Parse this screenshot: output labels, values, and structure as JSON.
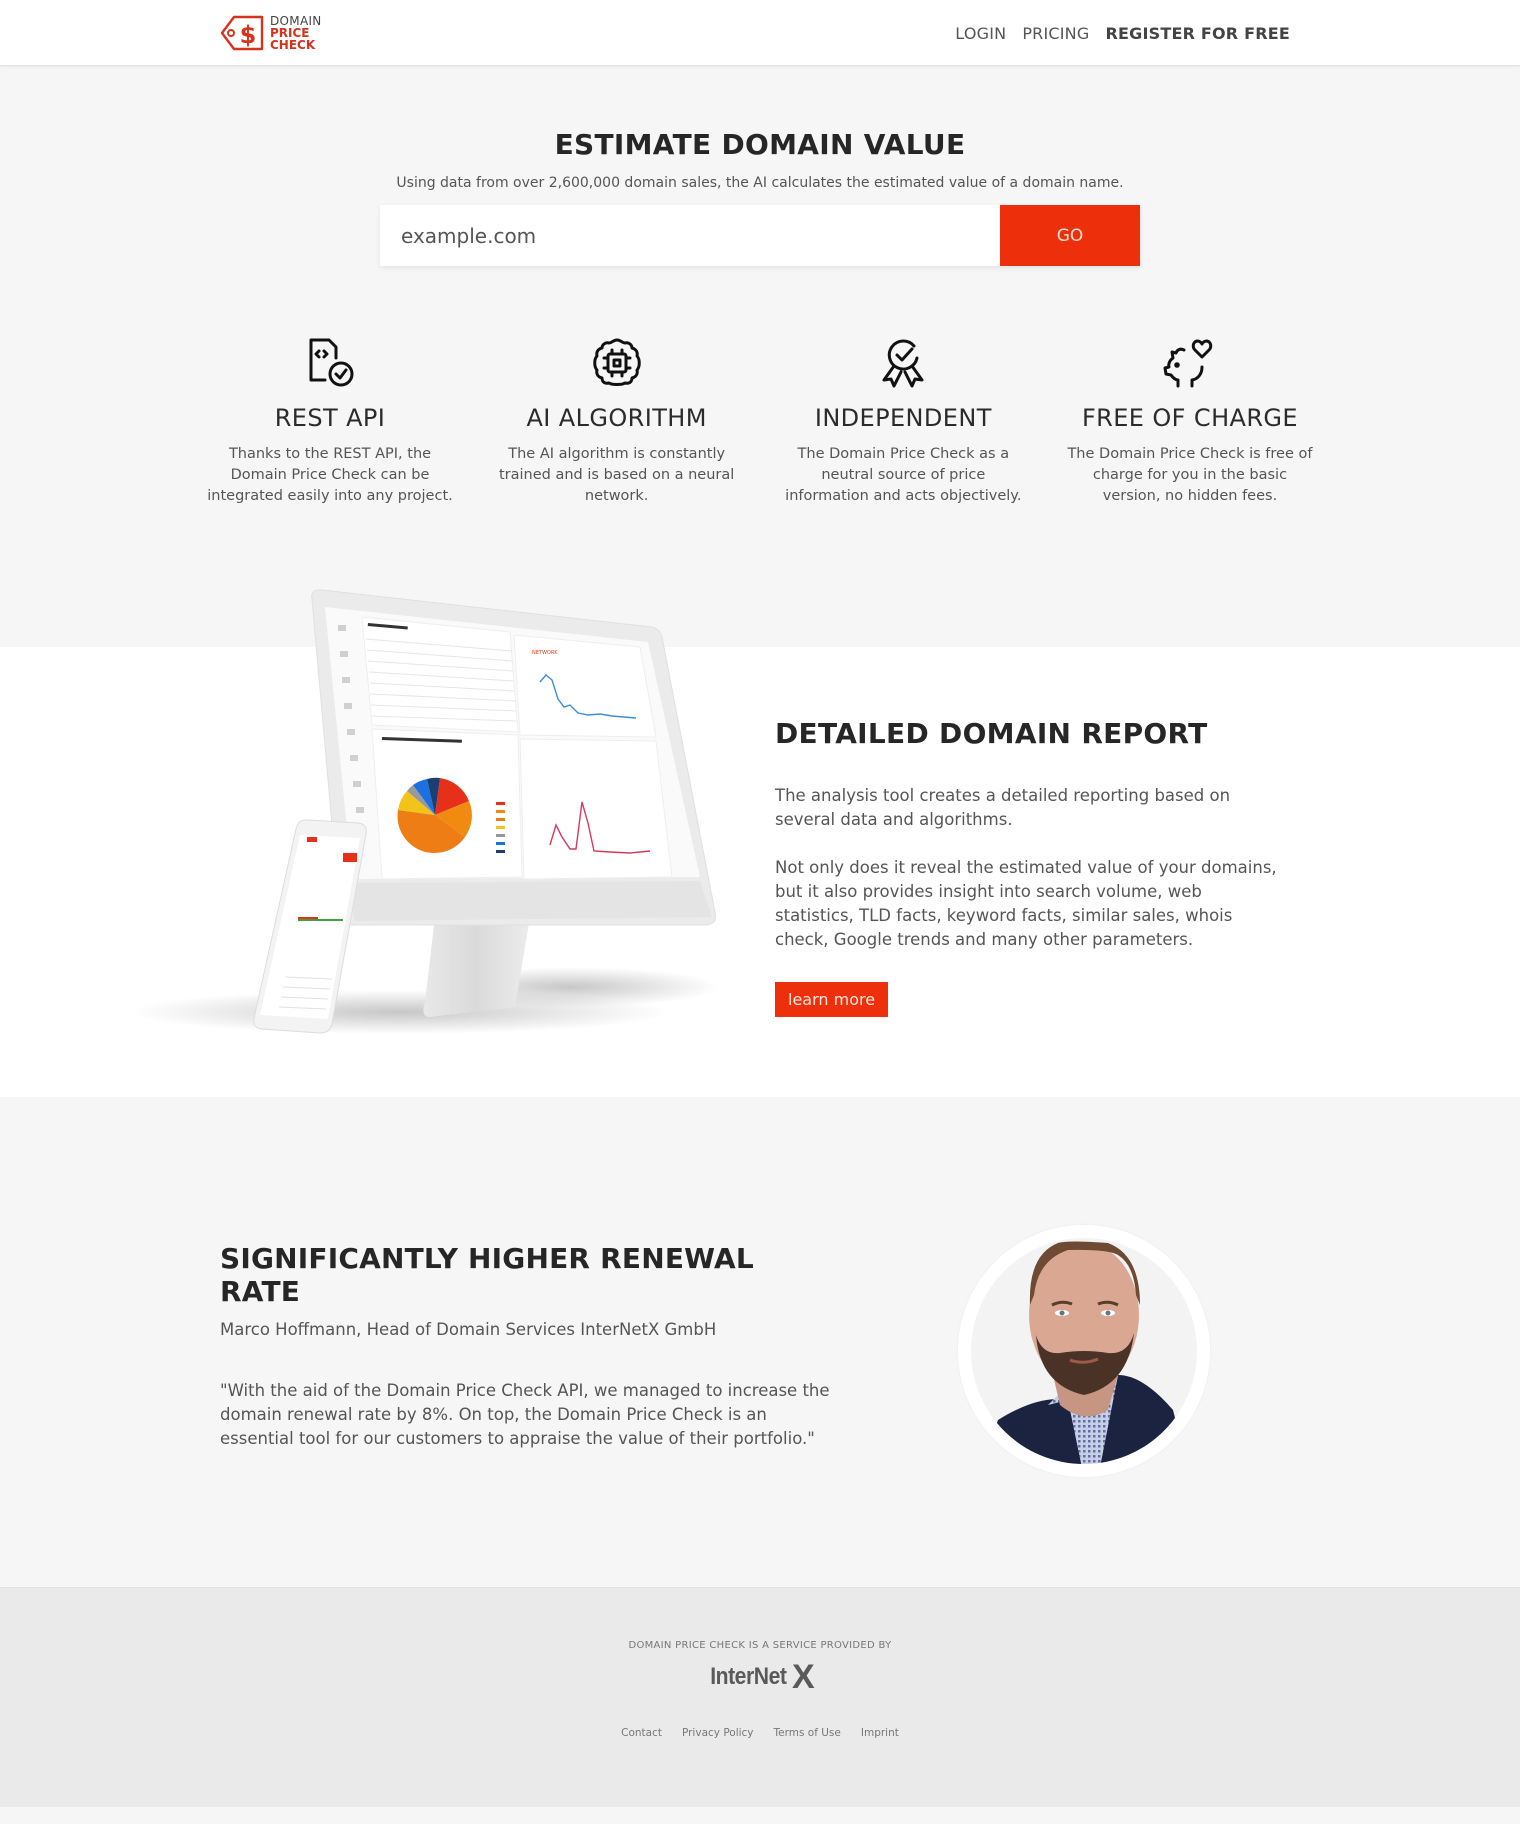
{
  "header": {
    "logo": {
      "line1": "DOMAIN",
      "line2": "PRICE",
      "line3": "CHECK",
      "icon": "price-tag-dollar-icon"
    },
    "nav": [
      {
        "label": "LOGIN"
      },
      {
        "label": "PRICING"
      },
      {
        "label": "REGISTER FOR FREE"
      }
    ]
  },
  "hero": {
    "title": "ESTIMATE DOMAIN VALUE",
    "subtitle": "Using data from over 2,600,000 domain sales, the AI calculates the estimated value of a domain name.",
    "search_placeholder": "example.com",
    "go_label": "GO"
  },
  "features": [
    {
      "icon": "file-code-check-icon",
      "title": "REST API",
      "text": "Thanks to the REST API, the Domain Price Check can be integrated easily into any project."
    },
    {
      "icon": "ai-chip-icon",
      "title": "AI ALGORITHM",
      "text": "The AI algorithm is constantly trained and is based on a neural network."
    },
    {
      "icon": "award-badge-check-icon",
      "title": "INDEPENDENT",
      "text": "The Domain Price Check as a neutral source of price information and acts objectively."
    },
    {
      "icon": "piggy-bank-heart-icon",
      "title": "FREE OF CHARGE",
      "text": "The Domain Price Check is free of charge for you in the basic version, no hidden fees."
    }
  ],
  "report": {
    "title": "DETAILED DOMAIN REPORT",
    "paragraph1": "The analysis tool creates a detailed reporting based on several data and algorithms.",
    "paragraph2": "Not only does it reveal the estimated value of your domains, but it also provides insight into search volume, web statistics, TLD facts, keyword facts, similar sales, whois check, Google trends and many other parameters.",
    "button_label": "learn more"
  },
  "testimonial": {
    "title": "SIGNIFICANTLY HIGHER RENEWAL RATE",
    "author": "Marco Hoffmann, Head of Domain Services InterNetX GmbH",
    "quote": "\"With the aid of the Domain Price Check API, we managed to increase the domain renewal rate by 8%. On top, the Domain Price Check is an essential tool for our customers to appraise the value of their portfolio.\""
  },
  "footer": {
    "provided_by": "DOMAIN PRICE CHECK IS A SERVICE PROVIDED BY",
    "brand": "InterNet",
    "brand_x": "X",
    "links": [
      {
        "label": "Contact"
      },
      {
        "label": "Privacy Policy"
      },
      {
        "label": "Terms of Use"
      },
      {
        "label": "Imprint"
      }
    ]
  },
  "colors": {
    "accent": "#ed2f0b",
    "logo_red": "#d6321c",
    "heading": "#262626",
    "body_text": "#555555",
    "page_bg": "#f6f6f6",
    "footer_bg": "#eaeaea"
  }
}
